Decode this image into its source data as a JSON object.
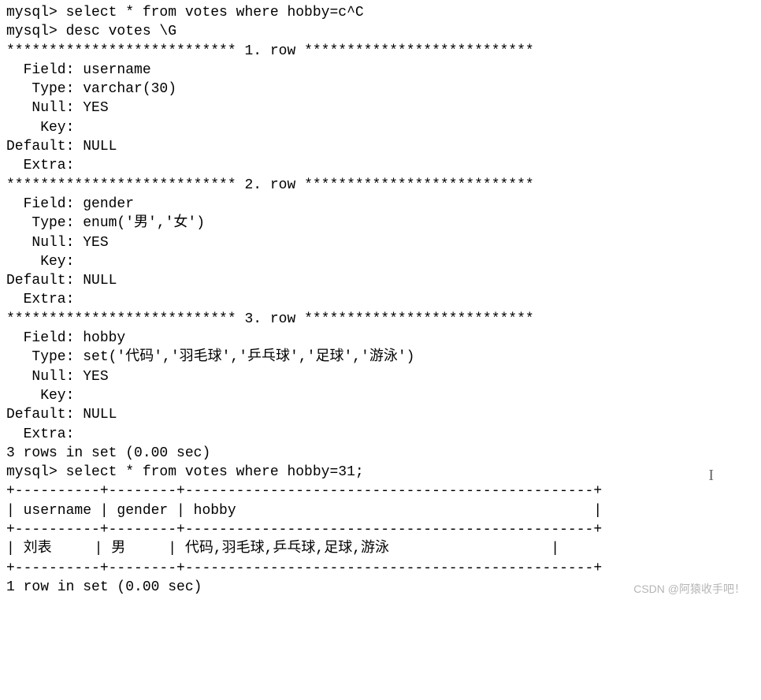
{
  "prompt": "mysql> ",
  "cmd1": "mysql> select * from votes where hobby=c^C",
  "cmd2": "mysql> desc votes \\G",
  "star_sep_left": "*************************** ",
  "star_sep_right": " ***************************",
  "rows": [
    {
      "header": "1. row",
      "Field": "  Field: username",
      "Type": "   Type: varchar(30)",
      "Null": "   Null: YES",
      "Key": "    Key: ",
      "Default": "Default: NULL",
      "Extra": "  Extra: "
    },
    {
      "header": "2. row",
      "Field": "  Field: gender",
      "Type": "   Type: enum('男','女')",
      "Null": "   Null: YES",
      "Key": "    Key: ",
      "Default": "Default: NULL",
      "Extra": "  Extra: "
    },
    {
      "header": "3. row",
      "Field": "  Field: hobby",
      "Type": "   Type: set('代码','羽毛球','乒乓球','足球','游泳')",
      "Null": "   Null: YES",
      "Key": "    Key: ",
      "Default": "Default: NULL",
      "Extra": "  Extra: "
    }
  ],
  "rows_footer": "3 rows in set (0.00 sec)",
  "blank": "",
  "cmd3": "mysql> select * from votes where hobby=31;",
  "table": {
    "border": "+----------+--------+------------------------------------------------+",
    "header": "| username | gender | hobby                                          |",
    "row1": "| 刘表     | 男     | 代码,羽毛球,乒乓球,足球,游泳                   |"
  },
  "result_footer": "1 row in set (0.00 sec)",
  "watermark": "CSDN @阿猿收手吧！",
  "chart_data": {
    "type": "table",
    "desc_votes": [
      {
        "Field": "username",
        "Type": "varchar(30)",
        "Null": "YES",
        "Key": "",
        "Default": "NULL",
        "Extra": ""
      },
      {
        "Field": "gender",
        "Type": "enum('男','女')",
        "Null": "YES",
        "Key": "",
        "Default": "NULL",
        "Extra": ""
      },
      {
        "Field": "hobby",
        "Type": "set('代码','羽毛球','乒乓球','足球','游泳')",
        "Null": "YES",
        "Key": "",
        "Default": "NULL",
        "Extra": ""
      }
    ],
    "select_result": {
      "columns": [
        "username",
        "gender",
        "hobby"
      ],
      "rows": [
        [
          "刘表",
          "男",
          "代码,羽毛球,乒乓球,足球,游泳"
        ]
      ]
    }
  }
}
